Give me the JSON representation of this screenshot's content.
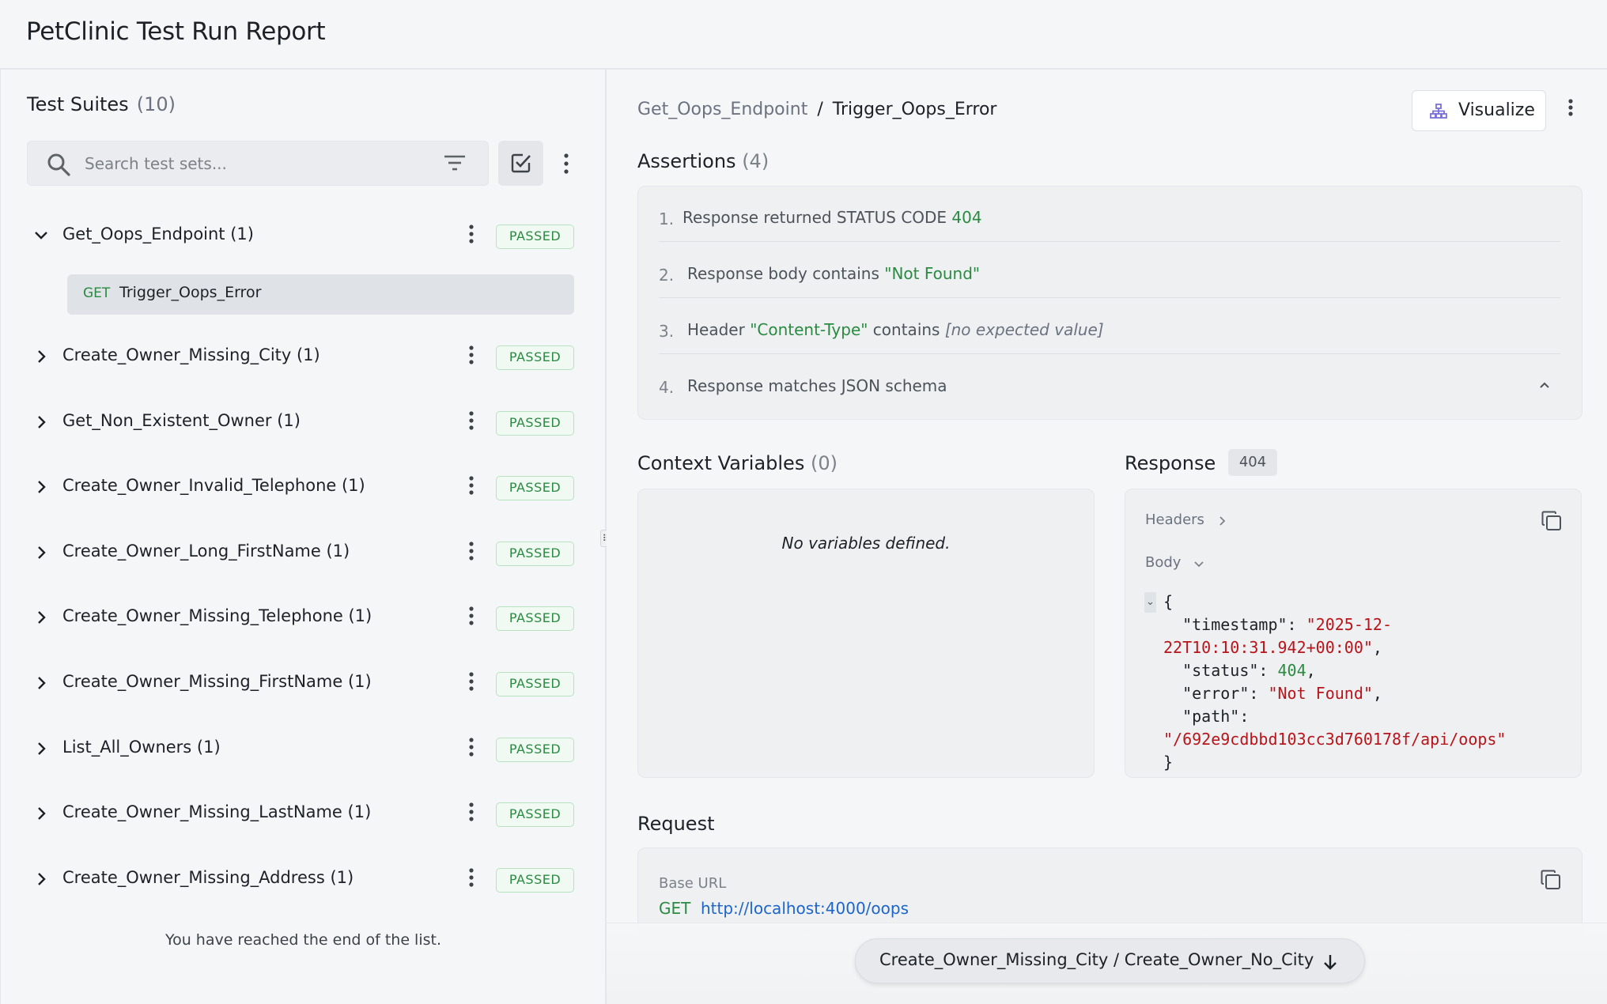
{
  "app": {
    "title": "PetClinic Test Run Report"
  },
  "sidebar": {
    "title": "Test Suites",
    "count": "(10)",
    "search": {
      "placeholder": "Search test sets...",
      "value": ""
    },
    "suites": [
      {
        "name": "Get_Oops_Endpoint (1)",
        "status": "PASSED",
        "expanded": true
      },
      {
        "name": "Create_Owner_Missing_City (1)",
        "status": "PASSED",
        "expanded": false
      },
      {
        "name": "Get_Non_Existent_Owner (1)",
        "status": "PASSED",
        "expanded": false
      },
      {
        "name": "Create_Owner_Invalid_Telephone (1)",
        "status": "PASSED",
        "expanded": false
      },
      {
        "name": "Create_Owner_Long_FirstName (1)",
        "status": "PASSED",
        "expanded": false
      },
      {
        "name": "Create_Owner_Missing_Telephone (1)",
        "status": "PASSED",
        "expanded": false
      },
      {
        "name": "Create_Owner_Missing_FirstName (1)",
        "status": "PASSED",
        "expanded": false
      },
      {
        "name": "List_All_Owners (1)",
        "status": "PASSED",
        "expanded": false
      },
      {
        "name": "Create_Owner_Missing_LastName (1)",
        "status": "PASSED",
        "expanded": false
      },
      {
        "name": "Create_Owner_Missing_Address (1)",
        "status": "PASSED",
        "expanded": false
      }
    ],
    "selected_test": {
      "method": "GET",
      "name": "Trigger_Oops_Error"
    },
    "end_message": "You have reached the end of the list."
  },
  "main": {
    "breadcrumb": {
      "suite": "Get_Oops_Endpoint",
      "separator": "/",
      "test": "Trigger_Oops_Error"
    },
    "visualize_label": "Visualize",
    "assertions": {
      "title": "Assertions",
      "count": "(4)",
      "items": [
        {
          "num": "1.",
          "pre": "Response returned STATUS CODE ",
          "highlight": "404",
          "post": "",
          "italic": ""
        },
        {
          "num": "2.",
          "pre": "Response body contains ",
          "highlight": "\"Not Found\"",
          "post": "",
          "italic": ""
        },
        {
          "num": "3.",
          "pre": "Header ",
          "highlight": "\"Content-Type\"",
          "post": " contains ",
          "italic": "[no expected value]"
        },
        {
          "num": "4.",
          "pre": "Response matches JSON schema",
          "highlight": "",
          "post": "",
          "italic": ""
        }
      ]
    },
    "context_variables": {
      "title": "Context Variables",
      "count": "(0)",
      "empty_text": "No variables defined."
    },
    "response": {
      "title": "Response",
      "status_code": "404",
      "headers_label": "Headers",
      "body_label": "Body",
      "json": {
        "open": "{",
        "timestamp_key": "\"timestamp\": ",
        "timestamp_val_1": "\"2025-12-",
        "timestamp_val_2": "22T10:10:31.942+00:00\"",
        "status_key": "\"status\": ",
        "status_val": "404",
        "error_key": "\"error\": ",
        "error_val": "\"Not Found\"",
        "path_key": "\"path\":",
        "path_val": "\"/692e9cdbbd103cc3d760178f/api/oops\"",
        "close": "}"
      }
    },
    "request": {
      "title": "Request",
      "base_url_label": "Base URL",
      "method": "GET",
      "url": "http://localhost:4000/oops"
    },
    "jump_button_label": "Create_Owner_Missing_City / Create_Owner_No_City"
  },
  "colors": {
    "passed_green": "#2a8a41",
    "json_string_red": "#b8151b",
    "link_blue": "#1d65c9",
    "background": "#f5f6f8"
  },
  "icons": [
    "search-icon",
    "filter-icon",
    "checkbox-icon",
    "kebab-icon",
    "chevron-down-icon",
    "chevron-right-icon",
    "chevron-up-icon",
    "hierarchy-icon",
    "copy-icon",
    "arrow-down-icon",
    "drag-handle-icon"
  ]
}
